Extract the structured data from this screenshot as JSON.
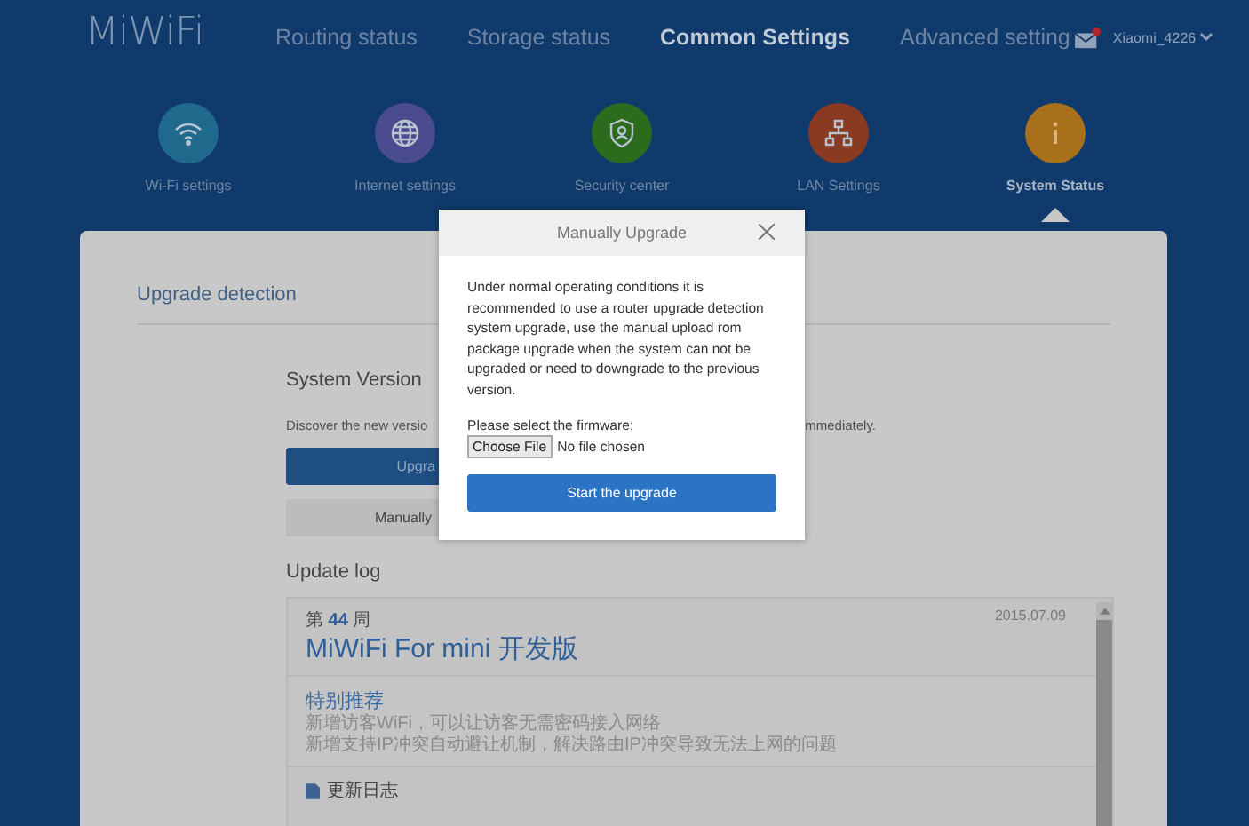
{
  "header": {
    "logo": "MiWiFi",
    "nav": [
      {
        "label": "Routing status",
        "selected": false
      },
      {
        "label": "Storage status",
        "selected": false
      },
      {
        "label": "Common Settings",
        "selected": true
      },
      {
        "label": "Advanced setting",
        "selected": false
      }
    ],
    "mail_unread": true,
    "user": "Xiaomi_4226"
  },
  "settings_icons": [
    {
      "label": "Wi-Fi settings",
      "kind": "wifi",
      "color": "#1f6a8c",
      "selected": false
    },
    {
      "label": "Internet settings",
      "kind": "globe",
      "color": "#4b4c8f",
      "selected": false
    },
    {
      "label": "Security center",
      "kind": "shield",
      "color": "#2c6b1e",
      "selected": false
    },
    {
      "label": "LAN Settings",
      "kind": "network",
      "color": "#8a3a20",
      "selected": false
    },
    {
      "label": "System Status",
      "kind": "info",
      "color": "#a8701a",
      "selected": true
    }
  ],
  "panel": {
    "title": "Upgrade detection",
    "system_version": {
      "heading": "System Version",
      "description_left": "Discover the new versio",
      "description_right": "mmediately.",
      "upgrade_button": "Upgra",
      "manual_button": "Manually"
    },
    "update_log": {
      "heading": "Update log",
      "entry": {
        "issue_prefix": "第",
        "issue_number": "44",
        "issue_suffix": "周",
        "date": "2015.07.09",
        "title": "MiWiFi For mini 开发版",
        "featured_heading": "特别推荐",
        "featured_lines": [
          "新增访客WiFi，可以让访客无需密码接入网络",
          "新增支持IP冲突自动避让机制，解决路由IP冲突导致无法上网的问题"
        ],
        "changelog_heading": "更新日志"
      }
    }
  },
  "dialog": {
    "title": "Manually Upgrade",
    "message": "Under normal operating conditions it is recommended to use a router upgrade detection system upgrade, use the manual upload rom package upgrade when the system can not be upgraded or need to downgrade to the previous version.",
    "firmware_label": "Please select the firmware:",
    "choose_file_button": "Choose File",
    "file_status": "No file chosen",
    "start_button": "Start the upgrade"
  }
}
